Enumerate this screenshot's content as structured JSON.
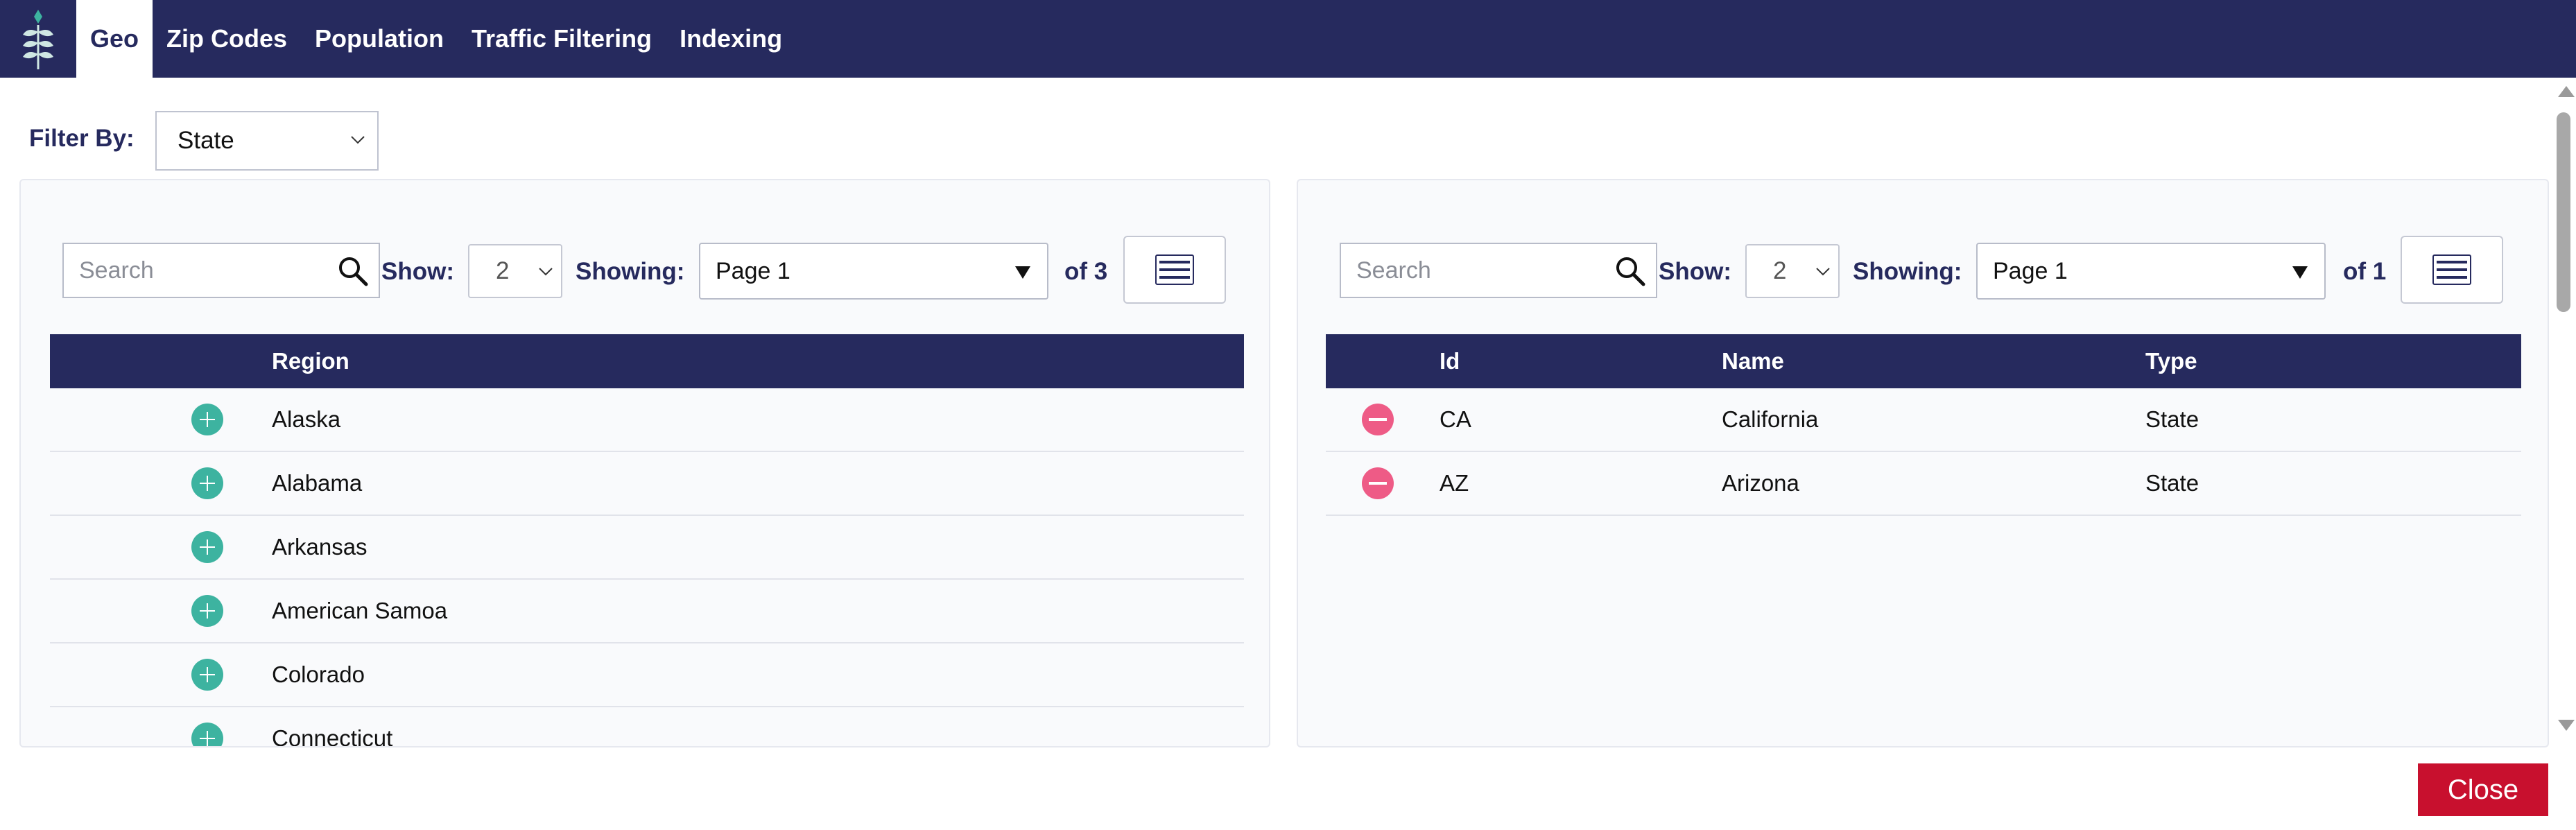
{
  "nav": {
    "tabs": [
      {
        "label": "Geo"
      },
      {
        "label": "Zip Codes"
      },
      {
        "label": "Population"
      },
      {
        "label": "Traffic Filtering"
      },
      {
        "label": "Indexing"
      }
    ],
    "active": "Geo"
  },
  "filter": {
    "label": "Filter By:",
    "value": "State"
  },
  "left": {
    "search_placeholder": "Search",
    "show_label": "Show:",
    "show_value": "2",
    "showing_label": "Showing:",
    "page_value": "Page 1",
    "of_text": "of 3",
    "columns": [
      "Region"
    ],
    "rows": [
      {
        "region": "Alaska"
      },
      {
        "region": "Alabama"
      },
      {
        "region": "Arkansas"
      },
      {
        "region": "American Samoa"
      },
      {
        "region": "Colorado"
      },
      {
        "region": "Connecticut"
      }
    ]
  },
  "right": {
    "search_placeholder": "Search",
    "show_label": "Show:",
    "show_value": "2",
    "showing_label": "Showing:",
    "page_value": "Page 1",
    "of_text": "of 1",
    "columns": [
      "Id",
      "Name",
      "Type"
    ],
    "rows": [
      {
        "id": "CA",
        "name": "California",
        "type": "State"
      },
      {
        "id": "AZ",
        "name": "Arizona",
        "type": "State"
      }
    ]
  },
  "close_label": "Close",
  "colors": {
    "nav": "#262a5e",
    "add": "#3db3a0",
    "remove": "#ee5b86",
    "close": "#c8102e"
  }
}
